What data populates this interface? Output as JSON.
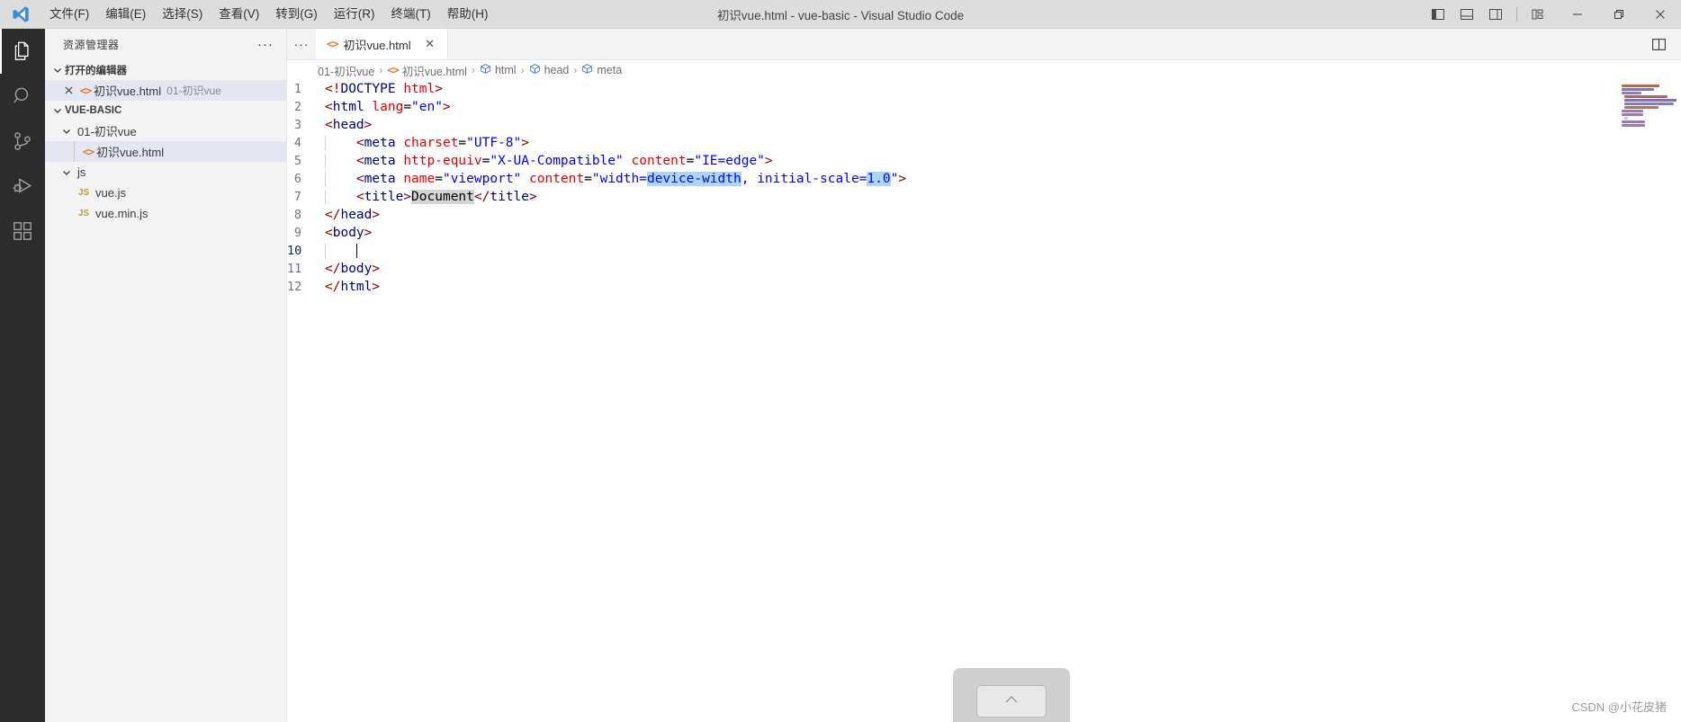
{
  "titlebar": {
    "logo_icon": "vscode-logo-icon",
    "window_title": "初识vue.html - vue-basic - Visual Studio Code",
    "menus": [
      {
        "label": "文件(F)",
        "name": "menu-file"
      },
      {
        "label": "编辑(E)",
        "name": "menu-edit"
      },
      {
        "label": "选择(S)",
        "name": "menu-selection"
      },
      {
        "label": "查看(V)",
        "name": "menu-view"
      },
      {
        "label": "转到(G)",
        "name": "menu-go"
      },
      {
        "label": "运行(R)",
        "name": "menu-run"
      },
      {
        "label": "终端(T)",
        "name": "menu-terminal"
      },
      {
        "label": "帮助(H)",
        "name": "menu-help"
      }
    ],
    "layout_icons": [
      {
        "name": "toggle-primary-sidebar-icon",
        "title": "切换主侧栏"
      },
      {
        "name": "toggle-panel-icon",
        "title": "切换面板"
      },
      {
        "name": "toggle-secondary-sidebar-icon",
        "title": "切换辅助侧栏"
      },
      {
        "name": "customize-layout-icon",
        "title": "自定义布局"
      }
    ],
    "window_controls": [
      {
        "name": "minimize-button",
        "glyph": "—"
      },
      {
        "name": "restore-button",
        "glyph": "❐"
      },
      {
        "name": "close-button",
        "glyph": "✕"
      }
    ]
  },
  "activitybar": {
    "items": [
      {
        "name": "activity-explorer",
        "icon": "files-icon",
        "active": true
      },
      {
        "name": "activity-search",
        "icon": "search-icon",
        "active": false
      },
      {
        "name": "activity-source-control",
        "icon": "source-control-icon",
        "active": false
      },
      {
        "name": "activity-run-debug",
        "icon": "run-and-debug-icon",
        "active": false
      },
      {
        "name": "activity-extensions",
        "icon": "extensions-icon",
        "active": false
      }
    ]
  },
  "sidebar": {
    "title": "资源管理器",
    "more_actions": "···",
    "open_editors": {
      "label": "打开的编辑器",
      "items": [
        {
          "name": "open-editor-item",
          "filename": "初识vue.html",
          "folder": "01-初识vue",
          "icon": "html-file-icon",
          "selected": true
        }
      ]
    },
    "workspace": {
      "label": "VUE-BASIC",
      "tree": [
        {
          "name": "folder-01-chushivue",
          "label": "01-初识vue",
          "type": "folder",
          "depth": 1,
          "expanded": true
        },
        {
          "name": "file-chushivue-html",
          "label": "初识vue.html",
          "type": "html",
          "depth": 2,
          "selected": true
        },
        {
          "name": "folder-js",
          "label": "js",
          "type": "folder",
          "depth": 1,
          "expanded": true
        },
        {
          "name": "file-vue-js",
          "label": "vue.js",
          "type": "js",
          "depth": 2,
          "selected": false
        },
        {
          "name": "file-vue-min-js",
          "label": "vue.min.js",
          "type": "js",
          "depth": 2,
          "selected": false
        }
      ]
    }
  },
  "editor": {
    "tab": {
      "label": "初识vue.html",
      "icon": "html-file-icon",
      "close_glyph": "✕",
      "more_glyph": "···"
    },
    "split_editor_icon": "split-editor-right-icon",
    "breadcrumbs": [
      {
        "name": "breadcrumb-folder",
        "label": "01-初识vue",
        "icon": ""
      },
      {
        "name": "breadcrumb-file",
        "label": "初识vue.html",
        "icon": "html-file-icon"
      },
      {
        "name": "breadcrumb-symbol-html",
        "label": "html",
        "icon": "symbol-field-icon"
      },
      {
        "name": "breadcrumb-symbol-head",
        "label": "head",
        "icon": "symbol-field-icon"
      },
      {
        "name": "breadcrumb-symbol-meta",
        "label": "meta",
        "icon": "symbol-field-icon"
      }
    ],
    "separator": "›",
    "lines": [
      {
        "n": "1",
        "indent": 0,
        "guide": false
      },
      {
        "n": "2",
        "indent": 0,
        "guide": false
      },
      {
        "n": "3",
        "indent": 0,
        "guide": false
      },
      {
        "n": "4",
        "indent": 1,
        "guide": true
      },
      {
        "n": "5",
        "indent": 1,
        "guide": true
      },
      {
        "n": "6",
        "indent": 1,
        "guide": true
      },
      {
        "n": "7",
        "indent": 1,
        "guide": true
      },
      {
        "n": "8",
        "indent": 0,
        "guide": false
      },
      {
        "n": "9",
        "indent": 0,
        "guide": false
      },
      {
        "n": "10",
        "indent": 1,
        "guide": true
      },
      {
        "n": "11",
        "indent": 0,
        "guide": false
      },
      {
        "n": "12",
        "indent": 0,
        "guide": false
      }
    ],
    "code_text": [
      "<!DOCTYPE html>",
      "<html lang=\"en\">",
      "<head>",
      "    <meta charset=\"UTF-8\">",
      "    <meta http-equiv=\"X-UA-Compatible\" content=\"IE=edge\">",
      "    <meta name=\"viewport\" content=\"width=device-width, initial-scale=1.0\">",
      "    <title>Document</title>",
      "</head>",
      "<body>",
      "    ",
      "</body>",
      "</html>"
    ],
    "cursor_line": "10",
    "selection_text": "device-width",
    "word_highlight_text": "Document",
    "colors": {
      "tag": "#000080",
      "attribute": "#e50000",
      "string": "#0000ff",
      "bracket": "#800000",
      "selection": "#add6ff",
      "word_highlight": "#d4d4d4",
      "line_number": "#6e7681",
      "active_line_number": "#0b216f"
    }
  },
  "overlay": {
    "ime_indicator_name": "ime-caps-indicator",
    "watermark": "CSDN @小花皮猪"
  }
}
